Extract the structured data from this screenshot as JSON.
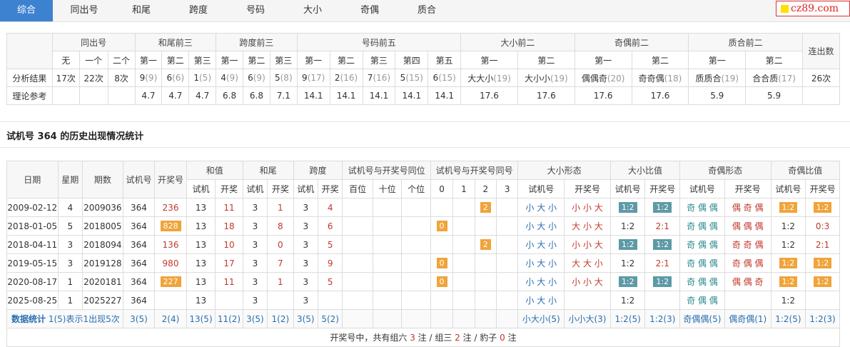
{
  "tabs": [
    "综合",
    "同出号",
    "和尾",
    "跨度",
    "号码",
    "大小",
    "奇偶",
    "质合"
  ],
  "logo_text": "cz89.com",
  "summary": {
    "groups": [
      "同出号",
      "和尾前三",
      "跨度前三",
      "号码前五",
      "大小前二",
      "奇偶前二",
      "质合前二",
      "连出数"
    ],
    "sub": {
      "tongchu": [
        "无",
        "一个",
        "二个"
      ],
      "hewei": [
        "第一",
        "第二",
        "第三"
      ],
      "kuadu": [
        "第一",
        "第二",
        "第三"
      ],
      "haoma": [
        "第一",
        "第二",
        "第三",
        "第四",
        "第五"
      ],
      "daxiao": [
        "第一",
        "第二"
      ],
      "jiou": [
        "第一",
        "第二"
      ],
      "zhihe": [
        "第一",
        "第二"
      ]
    },
    "row_labels": [
      "分析结果",
      "理论参考"
    ],
    "result": {
      "tongchu": [
        "17次",
        "22次",
        "8次"
      ],
      "hewei": [
        [
          "9",
          "(9)"
        ],
        [
          "6",
          "(6)"
        ],
        [
          "1",
          "(5)"
        ]
      ],
      "kuadu": [
        [
          "4",
          "(9)"
        ],
        [
          "6",
          "(9)"
        ],
        [
          "5",
          "(8)"
        ]
      ],
      "haoma": [
        [
          "9",
          "(17)"
        ],
        [
          "2",
          "(16)"
        ],
        [
          "7",
          "(16)"
        ],
        [
          "5",
          "(15)"
        ],
        [
          "6",
          "(15)"
        ]
      ],
      "daxiao": [
        [
          "大大小",
          "(19)"
        ],
        [
          "大小小",
          "(19)"
        ]
      ],
      "jiou": [
        [
          "偶偶奇",
          "(20)"
        ],
        [
          "奇奇偶",
          "(18)"
        ]
      ],
      "zhihe": [
        [
          "质质合",
          "(19)"
        ],
        [
          "合合质",
          "(17)"
        ]
      ],
      "lianchu": "26次"
    },
    "theory": {
      "hewei": [
        "4.7",
        "4.7",
        "4.7"
      ],
      "kuadu": [
        "6.8",
        "6.8",
        "7.1"
      ],
      "haoma": [
        "14.1",
        "14.1",
        "14.1",
        "14.1",
        "14.1"
      ],
      "daxiao": [
        "17.6",
        "17.6"
      ],
      "jiou": [
        "17.6",
        "17.6"
      ],
      "zhihe": [
        "5.9",
        "5.9"
      ]
    }
  },
  "section_title": "试机号 364 的历史出现情况统计",
  "history": {
    "headers": {
      "date": "日期",
      "week": "星期",
      "issue": "期数",
      "trial": "试机号",
      "draw": "开奖号",
      "sum": "和值",
      "tail": "和尾",
      "span": "跨度",
      "samepos": "试机号与开奖号同位",
      "samenum": "试机号与开奖号同号",
      "bigsmall_shape": "大小形态",
      "bigsmall_ratio": "大小比值",
      "oddeven_shape": "奇偶形态",
      "oddeven_ratio": "奇偶比值",
      "sub_trial": "试机",
      "sub_draw": "开奖",
      "pos": [
        "百位",
        "十位",
        "个位"
      ],
      "nums": [
        "0",
        "1",
        "2",
        "3"
      ],
      "sub_trialno": "试机号",
      "sub_drawno": "开奖号"
    },
    "rows": [
      {
        "date": "2009-02-12",
        "week": "4",
        "issue": "2009036",
        "trial": "364",
        "draw": "236",
        "draw_badge": false,
        "sum_t": "13",
        "sum_d": "11",
        "tail_t": "3",
        "tail_d": "1",
        "span_t": "3",
        "span_d": "4",
        "same": "2",
        "same_col": 2,
        "bs_t": "小 大 小",
        "bs_d": "小 小 大",
        "bsr_t": "1:2",
        "bsr_t_badge": true,
        "bsr_d": "1:2",
        "bsr_d_badge": true,
        "oe_t": "奇 偶 偶",
        "oe_d": "偶 奇 偶",
        "oer_t": "1:2",
        "oer_t_badge": true,
        "oer_d": "1:2",
        "oer_d_badge": true
      },
      {
        "date": "2018-01-05",
        "week": "5",
        "issue": "2018005",
        "trial": "364",
        "draw": "828",
        "draw_badge": true,
        "sum_t": "13",
        "sum_d": "18",
        "tail_t": "3",
        "tail_d": "8",
        "span_t": "3",
        "span_d": "6",
        "same": "0",
        "same_col": 0,
        "bs_t": "小 大 小",
        "bs_d": "大 小 大",
        "bsr_t": "1:2",
        "bsr_t_badge": false,
        "bsr_d": "2:1",
        "bsr_d_badge": false,
        "oe_t": "奇 偶 偶",
        "oe_d": "偶 偶 偶",
        "oer_t": "1:2",
        "oer_t_badge": false,
        "oer_d": "0:3",
        "oer_d_badge": false
      },
      {
        "date": "2018-04-11",
        "week": "3",
        "issue": "2018094",
        "trial": "364",
        "draw": "136",
        "draw_badge": false,
        "sum_t": "13",
        "sum_d": "10",
        "tail_t": "3",
        "tail_d": "0",
        "span_t": "3",
        "span_d": "5",
        "same": "2",
        "same_col": 2,
        "bs_t": "小 大 小",
        "bs_d": "小 小 大",
        "bsr_t": "1:2",
        "bsr_t_badge": true,
        "bsr_d": "1:2",
        "bsr_d_badge": true,
        "oe_t": "奇 偶 偶",
        "oe_d": "奇 奇 偶",
        "oer_t": "1:2",
        "oer_t_badge": false,
        "oer_d": "2:1",
        "oer_d_badge": false
      },
      {
        "date": "2019-05-15",
        "week": "3",
        "issue": "2019128",
        "trial": "364",
        "draw": "980",
        "draw_badge": false,
        "sum_t": "13",
        "sum_d": "17",
        "tail_t": "3",
        "tail_d": "7",
        "span_t": "3",
        "span_d": "9",
        "same": "0",
        "same_col": 0,
        "bs_t": "小 大 小",
        "bs_d": "大 大 小",
        "bsr_t": "1:2",
        "bsr_t_badge": false,
        "bsr_d": "2:1",
        "bsr_d_badge": false,
        "oe_t": "奇 偶 偶",
        "oe_d": "奇 偶 偶",
        "oer_t": "1:2",
        "oer_t_badge": true,
        "oer_d": "1:2",
        "oer_d_badge": true
      },
      {
        "date": "2020-08-17",
        "week": "1",
        "issue": "2020181",
        "trial": "364",
        "draw": "227",
        "draw_badge": true,
        "sum_t": "13",
        "sum_d": "11",
        "tail_t": "3",
        "tail_d": "1",
        "span_t": "3",
        "span_d": "5",
        "same": "0",
        "same_col": 0,
        "bs_t": "小 大 小",
        "bs_d": "小 小 大",
        "bsr_t": "1:2",
        "bsr_t_badge": true,
        "bsr_d": "1:2",
        "bsr_d_badge": true,
        "oe_t": "奇 偶 偶",
        "oe_d": "偶 偶 奇",
        "oer_t": "1:2",
        "oer_t_badge": true,
        "oer_d": "1:2",
        "oer_d_badge": true
      },
      {
        "date": "2025-08-25",
        "week": "1",
        "issue": "2025227",
        "trial": "364",
        "draw": "",
        "draw_badge": false,
        "sum_t": "13",
        "sum_d": "",
        "tail_t": "3",
        "tail_d": "",
        "span_t": "3",
        "span_d": "",
        "same": "",
        "same_col": -1,
        "bs_t": "小 大 小",
        "bs_d": "",
        "bsr_t": "1:2",
        "bsr_t_badge": false,
        "bsr_d": "",
        "bsr_d_badge": false,
        "oe_t": "奇 偶 偶",
        "oe_d": "",
        "oer_t": "1:2",
        "oer_t_badge": false,
        "oer_d": "",
        "oer_d_badge": false
      }
    ],
    "stats": {
      "label": "数据统计",
      "note": "1(5)表示1出现5次",
      "trial": "3(5)",
      "draw": "2(4)",
      "sum_t": "13(5)",
      "sum_d": "11(2)",
      "tail_t": "3(5)",
      "tail_d": "1(2)",
      "span_t": "3(5)",
      "span_d": "5(2)",
      "bs_t": "小大小(5)",
      "bs_d": "小小大(3)",
      "bsr_t": "1:2(5)",
      "bsr_d": "1:2(3)",
      "oe_t": "奇偶偶(5)",
      "oe_d": "偶奇偶(1)",
      "oer_t": "1:2(5)",
      "oer_d": "1:2(3)"
    },
    "footer": {
      "pre": "开奖号中，共有组六 ",
      "six": "3",
      "mid1": " 注 / 组三 ",
      "three": "2",
      "mid2": " 注 / 豹子 ",
      "bao": "0",
      "post": " 注"
    }
  }
}
